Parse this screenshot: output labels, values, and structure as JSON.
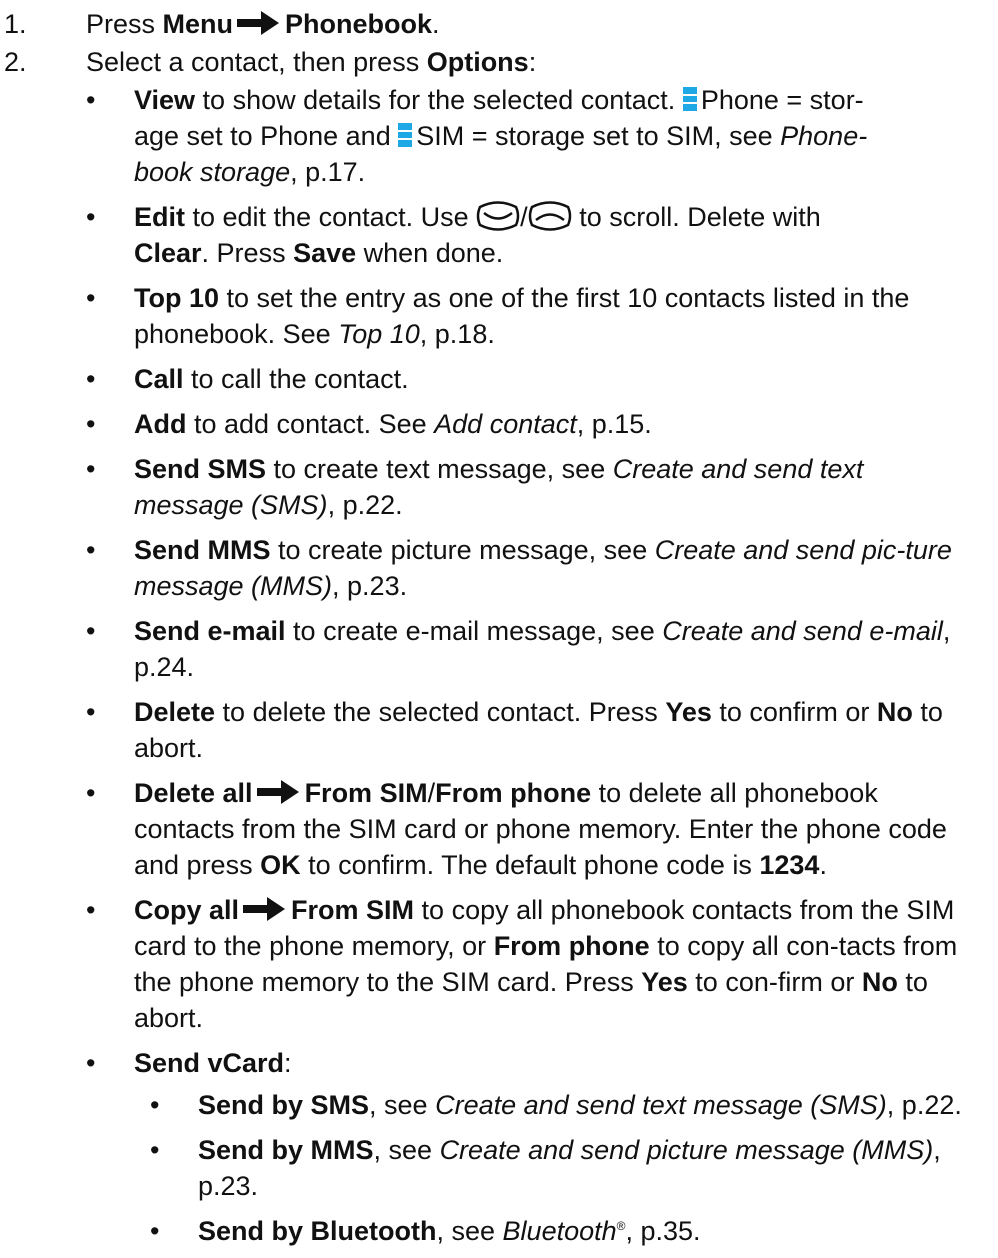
{
  "steps": [
    {
      "num": "1.",
      "pre": "Press ",
      "b1": "Menu",
      "b2": "Phonebook",
      "post": "."
    },
    {
      "num": "2.",
      "pre": "Select a contact, then press ",
      "b1": "Options",
      "post": ":"
    }
  ],
  "items": {
    "view": {
      "label": "View",
      "t1": " to show details for the selected contact. ",
      "t2": "Phone = stor-",
      "t3": "age set to Phone and ",
      "t4": "SIM = storage set to SIM, see ",
      "ref": "Phone-book storage",
      "ref_a": "Phone-",
      "ref_b": "book storage",
      "page": ", p.17."
    },
    "edit": {
      "label": "Edit",
      "t1": " to edit the contact. Use ",
      "sep": "/",
      "t2": " to scroll. Delete with",
      "clear": "Clear",
      "t3": ". Press ",
      "save": "Save",
      "t4": " when done."
    },
    "top10": {
      "label": "Top 10",
      "t1": " to set the entry as one of the first 10 contacts listed in the phonebook. See ",
      "ref": "Top 10",
      "page": ", p.18."
    },
    "call": {
      "label": "Call",
      "t1": " to call the contact."
    },
    "add": {
      "label": "Add",
      "t1": " to add contact. See ",
      "ref": "Add contact",
      "page": ", p.15."
    },
    "sms": {
      "label": "Send SMS",
      "t1": " to create text message, see ",
      "ref": "Create and send text message (SMS)",
      "page": ", p.22."
    },
    "mms": {
      "label": "Send MMS",
      "t1": " to create picture message, see ",
      "ref": "Create and send pic-ture message (MMS)",
      "page": ", p.23."
    },
    "email": {
      "label": "Send e-mail",
      "t1": " to create e-mail message, see ",
      "ref": "Create and send e-mail",
      "page": ", p.24."
    },
    "delete": {
      "label": "Delete",
      "t1": " to delete the selected contact. Press ",
      "yes": "Yes",
      "t2": " to confirm or ",
      "no": "No",
      "t3": " to abort."
    },
    "delete_all": {
      "label": "Delete all",
      "from_sim": "From SIM",
      "sep": "/",
      "from_phone": "From phone",
      "t1": " to delete all phonebook contacts from the SIM card or phone memory. Enter the phone code and press ",
      "ok": "OK",
      "t2": " to confirm. The default phone code is ",
      "code": "1234",
      "t3": "."
    },
    "copy_all": {
      "label": "Copy all",
      "from_sim": "From SIM",
      "t1": " to copy all phonebook contacts from the SIM card to the phone memory, or ",
      "from_phone": "From phone",
      "t2": " to copy all con-tacts from the phone memory to the SIM card. Press ",
      "yes": "Yes",
      "t3": " to con-firm or ",
      "no": "No",
      "t4": " to abort."
    },
    "vcard": {
      "label": "Send vCard",
      "colon": ":",
      "subs": [
        {
          "label": "Send by SMS",
          "t1": ", see ",
          "ref": "Create and send text message (SMS)",
          "page": ", p.22."
        },
        {
          "label": "Send by MMS",
          "t1": ", see ",
          "ref": "Create and send picture message (MMS)",
          "page": ", p.23."
        },
        {
          "label": "Send by Bluetooth",
          "t1": ", see ",
          "ref": "Bluetooth",
          "reg": "®",
          "page": ", p.35."
        }
      ]
    }
  },
  "icons": {
    "arrow": "right-arrow-icon",
    "storage": "storage-bar-icon",
    "down": "scroll-down-key-icon",
    "up": "scroll-up-key-icon"
  },
  "colors": {
    "storage_blue": "#1fa8e6",
    "text": "#111111"
  }
}
